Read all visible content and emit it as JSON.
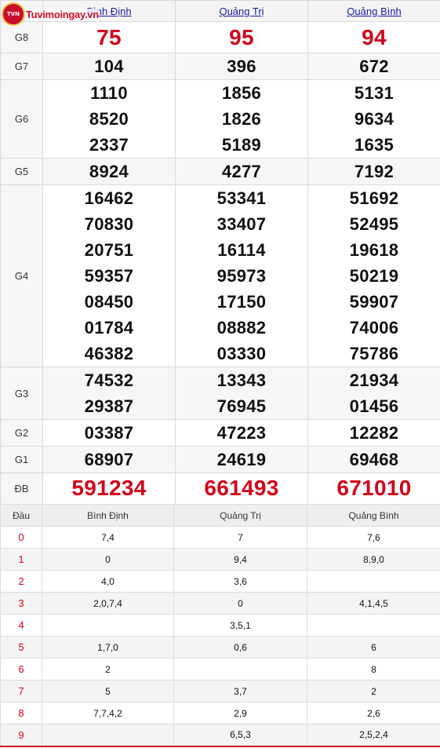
{
  "logo": {
    "badge": "TVN",
    "text": "Tuvimoingay.vn"
  },
  "provinces": [
    "Bình Định",
    "Quảng Trị",
    "Quảng Bình"
  ],
  "prizes": [
    {
      "name": "G8",
      "values": [
        [
          "75"
        ],
        [
          "95"
        ],
        [
          "94"
        ]
      ]
    },
    {
      "name": "G7",
      "values": [
        [
          "104"
        ],
        [
          "396"
        ],
        [
          "672"
        ]
      ]
    },
    {
      "name": "G6",
      "values": [
        [
          "1110",
          "8520",
          "2337"
        ],
        [
          "1856",
          "1826",
          "5189"
        ],
        [
          "5131",
          "9634",
          "1635"
        ]
      ]
    },
    {
      "name": "G5",
      "values": [
        [
          "8924"
        ],
        [
          "4277"
        ],
        [
          "7192"
        ]
      ]
    },
    {
      "name": "G4",
      "values": [
        [
          "16462",
          "70830",
          "20751",
          "59357",
          "08450",
          "01784",
          "46382"
        ],
        [
          "53341",
          "33407",
          "16114",
          "95973",
          "17150",
          "08882",
          "03330"
        ],
        [
          "51692",
          "52495",
          "19618",
          "50219",
          "59907",
          "74006",
          "75786"
        ]
      ]
    },
    {
      "name": "G3",
      "values": [
        [
          "74532",
          "29387"
        ],
        [
          "13343",
          "76945"
        ],
        [
          "21934",
          "01456"
        ]
      ]
    },
    {
      "name": "G2",
      "values": [
        [
          "03387"
        ],
        [
          "47223"
        ],
        [
          "12282"
        ]
      ]
    },
    {
      "name": "G1",
      "values": [
        [
          "68907"
        ],
        [
          "24619"
        ],
        [
          "69468"
        ]
      ]
    },
    {
      "name": "ĐB",
      "values": [
        [
          "591234"
        ],
        [
          "661493"
        ],
        [
          "671010"
        ]
      ]
    }
  ],
  "loto": {
    "header": "Đầu",
    "provinces": [
      "Bình Định",
      "Quảng Trị",
      "Quảng Bình"
    ],
    "rows": [
      {
        "dau": "0",
        "cols": [
          "7,4",
          "7",
          "7,6"
        ]
      },
      {
        "dau": "1",
        "cols": [
          "0",
          "9,4",
          "8,9,0"
        ]
      },
      {
        "dau": "2",
        "cols": [
          "4,0",
          "3,6",
          ""
        ]
      },
      {
        "dau": "3",
        "cols": [
          "2,0,7,4",
          "0",
          "4,1,4,5"
        ]
      },
      {
        "dau": "4",
        "cols": [
          "",
          "3,5,1",
          ""
        ]
      },
      {
        "dau": "5",
        "cols": [
          "1,7,0",
          "0,6",
          "6"
        ]
      },
      {
        "dau": "6",
        "cols": [
          "2",
          "",
          "8"
        ]
      },
      {
        "dau": "7",
        "cols": [
          "5",
          "3,7",
          "2"
        ]
      },
      {
        "dau": "8",
        "cols": [
          "7,7,4,2",
          "2,9",
          "2,6"
        ]
      },
      {
        "dau": "9",
        "cols": [
          "",
          "6,5,3",
          "2,5,2,4"
        ]
      }
    ]
  },
  "colors": {
    "accent": "#d0021b",
    "link": "#1a1aa6"
  }
}
